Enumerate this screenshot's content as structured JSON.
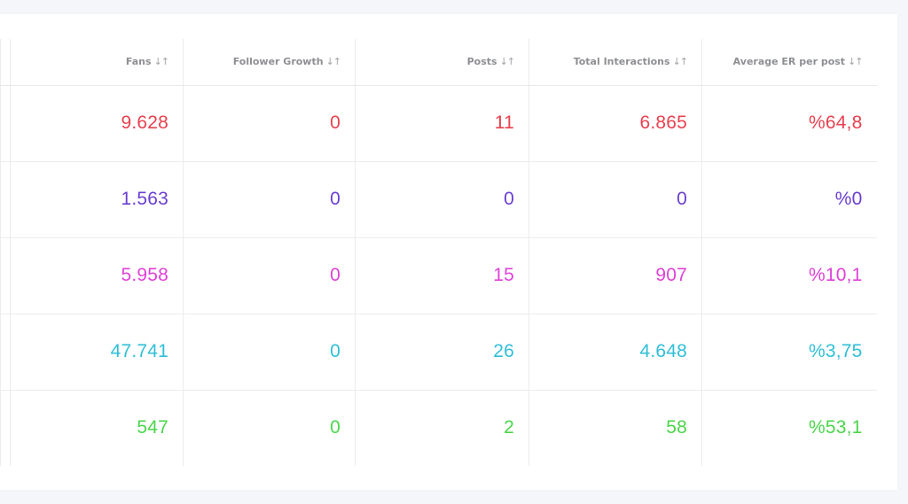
{
  "headers": {
    "fans": "Fans",
    "follower_growth": "Follower Growth",
    "posts": "Posts",
    "total_interactions": "Total Interactions",
    "average_er": "Average ER per post",
    "sort_glyph": "↓↑"
  },
  "rows": [
    {
      "color": "#e8414f",
      "fans": "9.628",
      "follower_growth": "0",
      "posts": "11",
      "total_interactions": "6.865",
      "average_er": "%64,8"
    },
    {
      "color": "#6a3fd2",
      "fans": "1.563",
      "follower_growth": "0",
      "posts": "0",
      "total_interactions": "0",
      "average_er": "%0"
    },
    {
      "color": "#e041d9",
      "fans": "5.958",
      "follower_growth": "0",
      "posts": "15",
      "total_interactions": "907",
      "average_er": "%10,1"
    },
    {
      "color": "#2fbfd8",
      "fans": "47.741",
      "follower_growth": "0",
      "posts": "26",
      "total_interactions": "4.648",
      "average_er": "%3,75"
    },
    {
      "color": "#4ad64a",
      "fans": "547",
      "follower_growth": "0",
      "posts": "2",
      "total_interactions": "58",
      "average_er": "%53,1"
    }
  ]
}
